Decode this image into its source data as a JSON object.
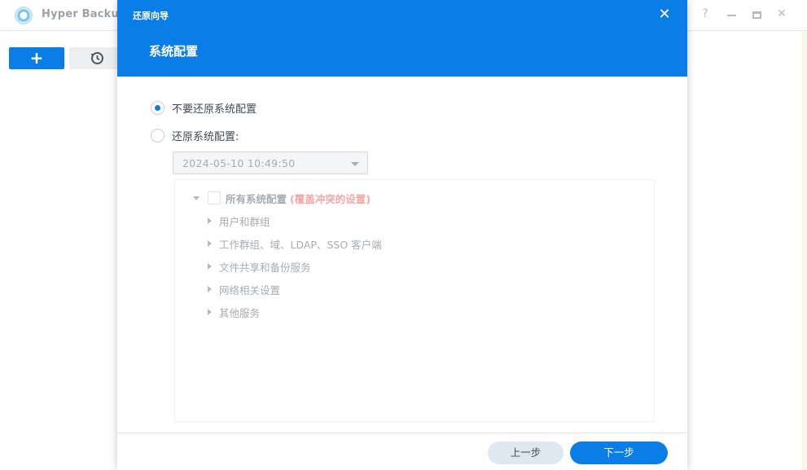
{
  "app": {
    "title": "Hyper Backup",
    "window_controls": {
      "help": "?",
      "minimize": "minimize",
      "maximize": "maximize",
      "close": "✕"
    },
    "toolbar": {
      "add_label": "+",
      "restore_icon": "history-icon"
    }
  },
  "dialog": {
    "window_title": "还原向导",
    "close_label": "✕",
    "heading": "系统配置",
    "options": [
      {
        "label": "不要还原系统配置",
        "checked": true
      },
      {
        "label": "还原系统配置:",
        "checked": false
      }
    ],
    "version_select": {
      "value": "2024-05-10 10:49:50"
    },
    "tree": {
      "root_label": "所有系统配置",
      "root_note": "(覆盖冲突的设置)",
      "items": [
        {
          "label": "用户和群组"
        },
        {
          "label": "工作群组、域、LDAP、SSO 客户端"
        },
        {
          "label": "文件共享和备份服务"
        },
        {
          "label": "网络相关设置"
        },
        {
          "label": "其他服务"
        }
      ]
    },
    "footer": {
      "prev_label": "上一步",
      "next_label": "下一步"
    }
  },
  "colors": {
    "accent": "#0a7ee6",
    "warning_note": "#f0a8a8",
    "disabled_text": "#a5adb4"
  }
}
